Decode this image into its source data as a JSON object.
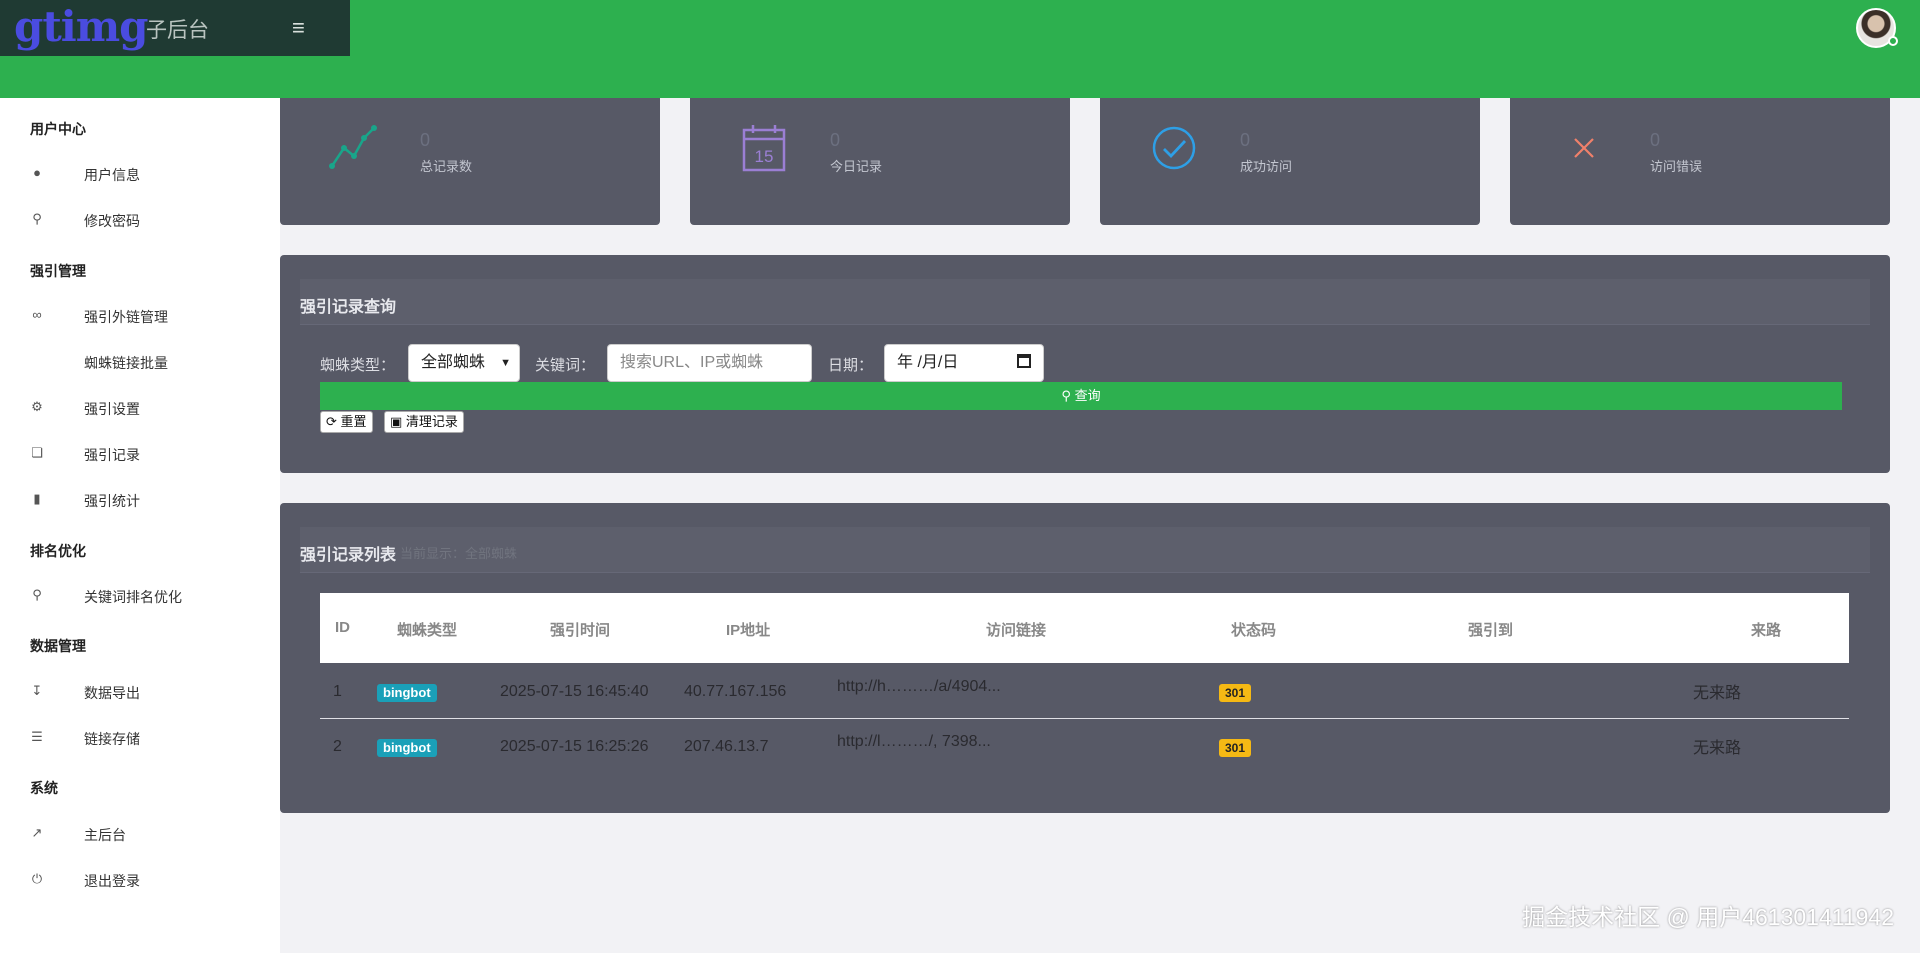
{
  "header": {
    "logo": "gtimg",
    "subtitle": "子后台",
    "menu_icon": "≡"
  },
  "sidebar": {
    "sections": [
      {
        "title": "用户中心",
        "items": [
          {
            "label": "用户信息",
            "icon": "user-icon"
          },
          {
            "label": "修改密码",
            "icon": "key-icon"
          }
        ]
      },
      {
        "title": "强引管理",
        "items": [
          {
            "label": "强引外链管理",
            "icon": "link-icon"
          },
          {
            "label": "蜘蛛链接批量",
            "icon": ""
          },
          {
            "label": "强引设置",
            "icon": "cogs-icon"
          },
          {
            "label": "强引记录",
            "icon": "files-icon"
          },
          {
            "label": "强引统计",
            "icon": "bar-chart-icon"
          }
        ]
      },
      {
        "title": "排名优化",
        "items": [
          {
            "label": "关键词排名优化",
            "icon": "search-icon"
          }
        ]
      },
      {
        "title": "数据管理",
        "items": [
          {
            "label": "数据导出",
            "icon": "download-icon"
          },
          {
            "label": "链接存储",
            "icon": "database-icon"
          }
        ]
      },
      {
        "title": "系统",
        "items": [
          {
            "label": "主后台",
            "icon": "external-link-icon"
          },
          {
            "label": "退出登录",
            "icon": "power-icon"
          }
        ]
      }
    ]
  },
  "stats": [
    {
      "count": "0",
      "label": "总记录数",
      "icon": "line-chart-icon",
      "color": "#19a58a"
    },
    {
      "count": "0",
      "label": "今日记录",
      "icon": "calendar-icon",
      "color": "#9b7fd4",
      "day": "15"
    },
    {
      "count": "0",
      "label": "成功访问",
      "icon": "check-circle-icon",
      "color": "#2e9fe6"
    },
    {
      "count": "0",
      "label": "访问错误",
      "icon": "close-icon",
      "color": "#f0806a"
    }
  ],
  "query": {
    "title": "强引记录查询",
    "spider_label": "蜘蛛类型：",
    "spider_value": "全部蜘蛛",
    "keyword_label": "关键词：",
    "keyword_placeholder": "搜索URL、IP或蜘蛛",
    "date_label": "日期：",
    "date_placeholder": "年 /月/日",
    "search_button": "查询",
    "reset_button": "重置",
    "clear_button": "清理记录"
  },
  "list": {
    "title": "强引记录列表",
    "subtitle": "当前显示：全部蜘蛛",
    "columns": [
      "ID",
      "蜘蛛类型",
      "强引时间",
      "IP地址",
      "访问链接",
      "状态码",
      "强引到",
      "来路"
    ],
    "rows": [
      {
        "id": "1",
        "spider": "bingbot",
        "time": "2025-07-15 16:45:40",
        "ip": "40.77.167.156",
        "url": "http://h………/a/4904...",
        "code": "301",
        "target": "",
        "source": "无来路"
      },
      {
        "id": "2",
        "spider": "bingbot",
        "time": "2025-07-15 16:25:26",
        "ip": "207.46.13.7",
        "url": "http://l………/, 7398...",
        "code": "301",
        "target": "",
        "source": "无来路"
      }
    ]
  },
  "watermark": "掘金技术社区 @ 用户461301411942",
  "colors": {
    "accent": "#2db04f",
    "panel": "#575966",
    "brand_bg": "#1f3a33",
    "logo": "#4a4ce0",
    "badge_bot": "#1aa0b8",
    "badge_code": "#f5b914"
  }
}
